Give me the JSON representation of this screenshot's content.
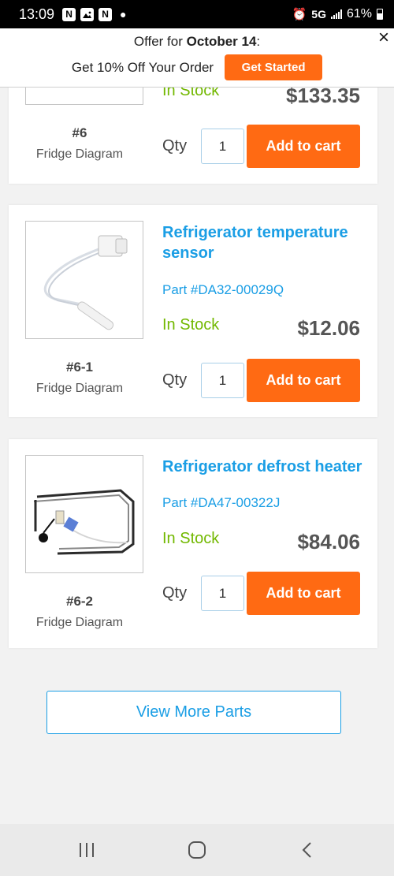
{
  "status_bar": {
    "time": "13:09",
    "network": "5G",
    "battery": "61%",
    "icons": [
      "n-notification-icon",
      "gallery-icon",
      "n-notification-icon",
      "alarm-icon",
      "signal-icon",
      "battery-icon"
    ]
  },
  "offer": {
    "prefix": "Offer for ",
    "date": "October 14",
    "suffix": ":",
    "text": "Get 10% Off Your Order",
    "button_label": "Get Started",
    "close_icon": "×"
  },
  "parts": [
    {
      "stock": "In Stock",
      "price": "$133.35",
      "diagram_number": "#6",
      "diagram_label": "Fridge Diagram",
      "qty_label": "Qty",
      "qty_value": "1",
      "button_label": "Add to cart"
    },
    {
      "title": "Refrigerator temperature sensor",
      "part_number": "Part #DA32-00029Q",
      "stock": "In Stock",
      "price": "$12.06",
      "diagram_number": "#6-1",
      "diagram_label": "Fridge Diagram",
      "qty_label": "Qty",
      "qty_value": "1",
      "button_label": "Add to cart"
    },
    {
      "title": "Refrigerator defrost heater",
      "part_number": "Part #DA47-00322J",
      "stock": "In Stock",
      "price": "$84.06",
      "diagram_number": "#6-2",
      "diagram_label": "Fridge Diagram",
      "qty_label": "Qty",
      "qty_value": "1",
      "button_label": "Add to cart"
    }
  ],
  "view_more_label": "View More Parts",
  "colors": {
    "accent_orange": "#ff6a13",
    "link_blue": "#1a9ee5",
    "stock_green": "#72b800"
  }
}
